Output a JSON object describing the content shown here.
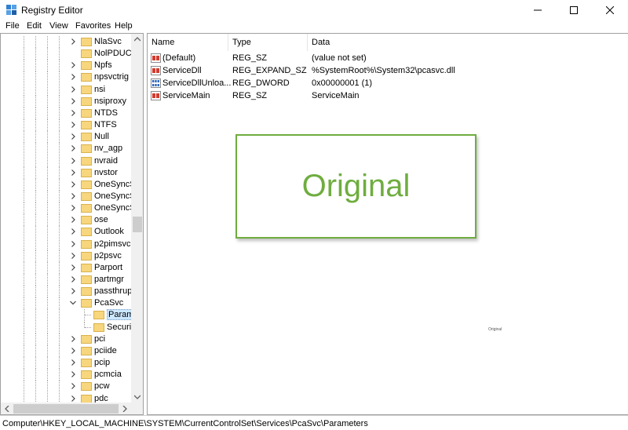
{
  "window": {
    "title": "Registry Editor",
    "minimize_label": "",
    "maximize_label": "",
    "close_label": ""
  },
  "menu": [
    "File",
    "Edit",
    "View",
    "Favorites",
    "Help"
  ],
  "tree": {
    "items": [
      {
        "label": "NlaSvc",
        "expander": "collapsed"
      },
      {
        "label": "NolPDUCS",
        "expander": "none"
      },
      {
        "label": "Npfs",
        "expander": "collapsed"
      },
      {
        "label": "npsvctrig",
        "expander": "collapsed"
      },
      {
        "label": "nsi",
        "expander": "collapsed"
      },
      {
        "label": "nsiproxy",
        "expander": "collapsed"
      },
      {
        "label": "NTDS",
        "expander": "collapsed"
      },
      {
        "label": "NTFS",
        "expander": "collapsed"
      },
      {
        "label": "Null",
        "expander": "collapsed"
      },
      {
        "label": "nv_agp",
        "expander": "collapsed"
      },
      {
        "label": "nvraid",
        "expander": "collapsed"
      },
      {
        "label": "nvstor",
        "expander": "collapsed"
      },
      {
        "label": "OneSyncSv",
        "expander": "collapsed"
      },
      {
        "label": "OneSyncSv",
        "expander": "collapsed"
      },
      {
        "label": "OneSyncSv",
        "expander": "collapsed"
      },
      {
        "label": "ose",
        "expander": "collapsed"
      },
      {
        "label": "Outlook",
        "expander": "collapsed"
      },
      {
        "label": "p2pimsvc",
        "expander": "collapsed"
      },
      {
        "label": "p2psvc",
        "expander": "collapsed"
      },
      {
        "label": "Parport",
        "expander": "collapsed"
      },
      {
        "label": "partmgr",
        "expander": "collapsed"
      },
      {
        "label": "passthrupa",
        "expander": "collapsed"
      },
      {
        "label": "PcaSvc",
        "expander": "expanded"
      },
      {
        "label": "Parame",
        "expander": "child",
        "selected": true
      },
      {
        "label": "Security",
        "expander": "child-last"
      },
      {
        "label": "pci",
        "expander": "collapsed"
      },
      {
        "label": "pciide",
        "expander": "collapsed"
      },
      {
        "label": "pcip",
        "expander": "collapsed"
      },
      {
        "label": "pcmcia",
        "expander": "collapsed"
      },
      {
        "label": "pcw",
        "expander": "collapsed"
      },
      {
        "label": "pdc",
        "expander": "collapsed"
      }
    ]
  },
  "values": {
    "columns": {
      "name": "Name",
      "type": "Type",
      "data": "Data"
    },
    "rows": [
      {
        "icon": "string-value-icon",
        "name": "(Default)",
        "type": "REG_SZ",
        "data": "(value not set)"
      },
      {
        "icon": "string-value-icon",
        "name": "ServiceDll",
        "type": "REG_EXPAND_SZ",
        "data": "%SystemRoot%\\System32\\pcasvc.dll"
      },
      {
        "icon": "binary-value-icon",
        "name": "ServiceDllUnloa...",
        "type": "REG_DWORD",
        "data": "0x00000001 (1)"
      },
      {
        "icon": "string-value-icon",
        "name": "ServiceMain",
        "type": "REG_SZ",
        "data": "ServiceMain"
      }
    ]
  },
  "watermark": {
    "text": "Original",
    "small_text": "Original"
  },
  "status": {
    "path": "Computer\\HKEY_LOCAL_MACHINE\\SYSTEM\\CurrentControlSet\\Services\\PcaSvc\\Parameters"
  },
  "colors": {
    "accent": "#6fad3f",
    "selection": "#cce8ff",
    "folder": "#f7d67d"
  }
}
